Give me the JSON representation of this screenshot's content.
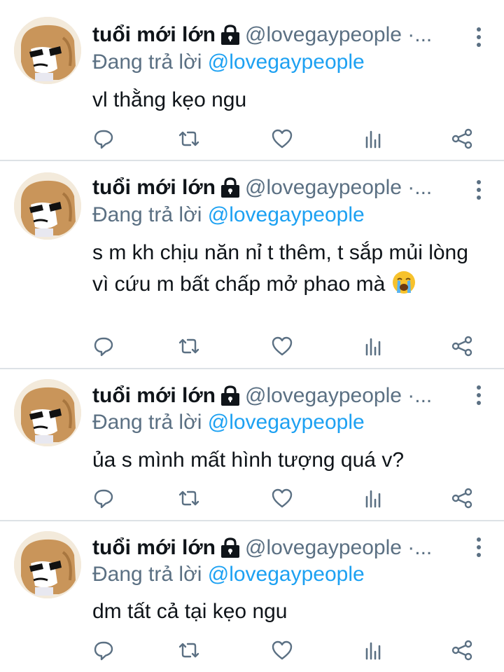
{
  "account": {
    "display_name": "tuổi mới lớn",
    "handle": "@lovegaypeople ·...",
    "reply_prefix": "Đang trả lời ",
    "reply_mention": "@lovegaypeople"
  },
  "tweets": [
    {
      "text": "vl thằng kẹo ngu"
    },
    {
      "text": "s m kh chịu năn nỉ t thêm, t sắp mủi lòng vì cứu m bất chấp mở phao mà",
      "emoji": "😭"
    },
    {
      "text": "ủa s mình mất hình tượng quá v?"
    },
    {
      "text": "dm tất cả tại kẹo ngu"
    }
  ],
  "icons": {
    "lock": "lock-icon",
    "more": "more-vertical-icon",
    "reply": "reply-icon",
    "retweet": "retweet-icon",
    "like": "heart-icon",
    "analytics": "analytics-icon",
    "share": "share-icon",
    "emoji": "loudly-crying-face"
  },
  "colors": {
    "text": "#0f1419",
    "secondary": "#5b7083",
    "mention": "#1da1f2",
    "divider": "#dde2e6"
  }
}
